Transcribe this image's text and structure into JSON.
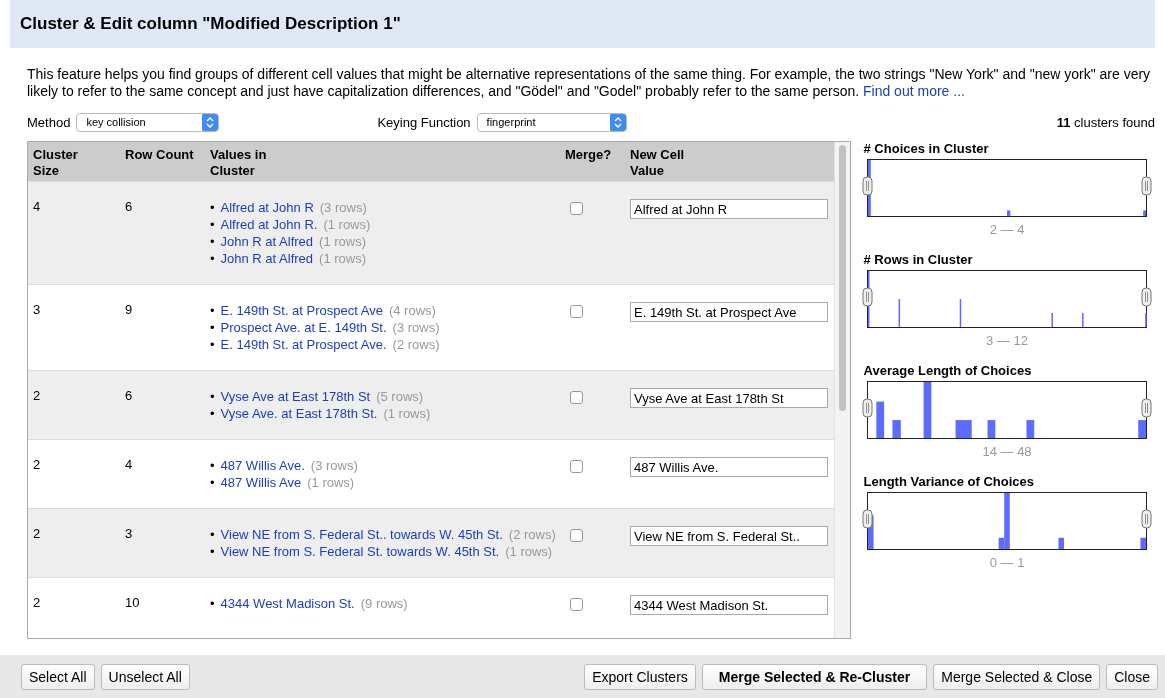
{
  "dialog": {
    "title": "Cluster & Edit column \"Modified Description 1\""
  },
  "description": {
    "text": "This feature helps you find groups of different cell values that might be alternative representations of the same thing. For example, the two strings \"New York\" and \"new york\" are very likely to refer to the same concept and just have capitalization differences, and \"Gödel\" and \"Godel\" probably refer to the same person.",
    "link": "Find out more ..."
  },
  "method": {
    "label": "Method",
    "value": "key collision"
  },
  "keying_function": {
    "label": "Keying Function",
    "value": "fingerprint"
  },
  "clusters_found": {
    "count": "11",
    "label": "clusters found"
  },
  "table": {
    "columns": [
      "Cluster Size",
      "Row Count",
      "Values in Cluster",
      "Merge?",
      "New Cell Value"
    ],
    "rows": [
      {
        "size": "4",
        "count": "6",
        "merge": false,
        "new_value": "Alfred at John R",
        "values": [
          {
            "bullet": "•",
            "text": "Alfred at John R",
            "rows": "(3 rows)"
          },
          {
            "bullet": "•",
            "text": "Alfred at John R.",
            "rows": "(1 rows)"
          },
          {
            "bullet": "•",
            "text": "John R at Alfred",
            "rows": "(1 rows)"
          },
          {
            "bullet": "•",
            "text": "John R at Alfred",
            "rows": "(1 rows)"
          }
        ]
      },
      {
        "size": "3",
        "count": "9",
        "merge": false,
        "new_value": "E. 149th St. at Prospect Ave",
        "values": [
          {
            "bullet": "•",
            "text": "E. 149th St. at Prospect Ave",
            "rows": "(4 rows)"
          },
          {
            "bullet": "•",
            "text": "Prospect Ave. at E. 149th St.",
            "rows": "(3 rows)"
          },
          {
            "bullet": "•",
            "text": "E. 149th St. at Prospect Ave.",
            "rows": "(2 rows)"
          }
        ]
      },
      {
        "size": "2",
        "count": "6",
        "merge": false,
        "new_value": "Vyse Ave at East 178th St",
        "values": [
          {
            "bullet": "•",
            "text": "Vyse Ave at East 178th St",
            "rows": "(5 rows)"
          },
          {
            "bullet": "•",
            "text": "Vyse Ave. at East 178th St.",
            "rows": "(1 rows)"
          }
        ]
      },
      {
        "size": "2",
        "count": "4",
        "merge": false,
        "new_value": "487 Willis Ave.",
        "values": [
          {
            "bullet": "•",
            "text": "487 Willis Ave.",
            "rows": "(3 rows)"
          },
          {
            "bullet": "•",
            "text": "487 Willis Ave",
            "rows": "(1 rows)"
          }
        ]
      },
      {
        "size": "2",
        "count": "3",
        "merge": false,
        "new_value": "View NE from S. Federal St..",
        "values": [
          {
            "bullet": "•",
            "text": "View NE from S. Federal St.. towards W. 45th St.",
            "rows": "(2 rows)"
          },
          {
            "bullet": "•",
            "text": "View NE from S. Federal St. towards W. 45th St.",
            "rows": "(1 rows)"
          }
        ]
      },
      {
        "size": "2",
        "count": "10",
        "merge": false,
        "new_value": "4344 West Madison St.",
        "values": [
          {
            "bullet": "•",
            "text": "4344 West Madison St.",
            "rows": "(9 rows)"
          }
        ]
      }
    ]
  },
  "histograms": [
    {
      "title": "# Choices in Cluster",
      "range": "2 — 4"
    },
    {
      "title": "# Rows in Cluster",
      "range": "3 — 12"
    },
    {
      "title": "Average Length of Choices",
      "range": "14 — 48"
    },
    {
      "title": "Length Variance of Choices",
      "range": "0 — 1"
    }
  ],
  "buttons_left": [
    {
      "label": "Select All",
      "kind": "normal"
    },
    {
      "label": "Unselect All",
      "kind": "normal"
    }
  ],
  "buttons_right": [
    {
      "label": "Export Clusters",
      "kind": "normal"
    },
    {
      "label": "Merge Selected & Re-Cluster",
      "kind": "primary"
    },
    {
      "label": "Merge Selected & Close",
      "kind": "normal"
    },
    {
      "label": "Close",
      "kind": "normal"
    }
  ]
}
